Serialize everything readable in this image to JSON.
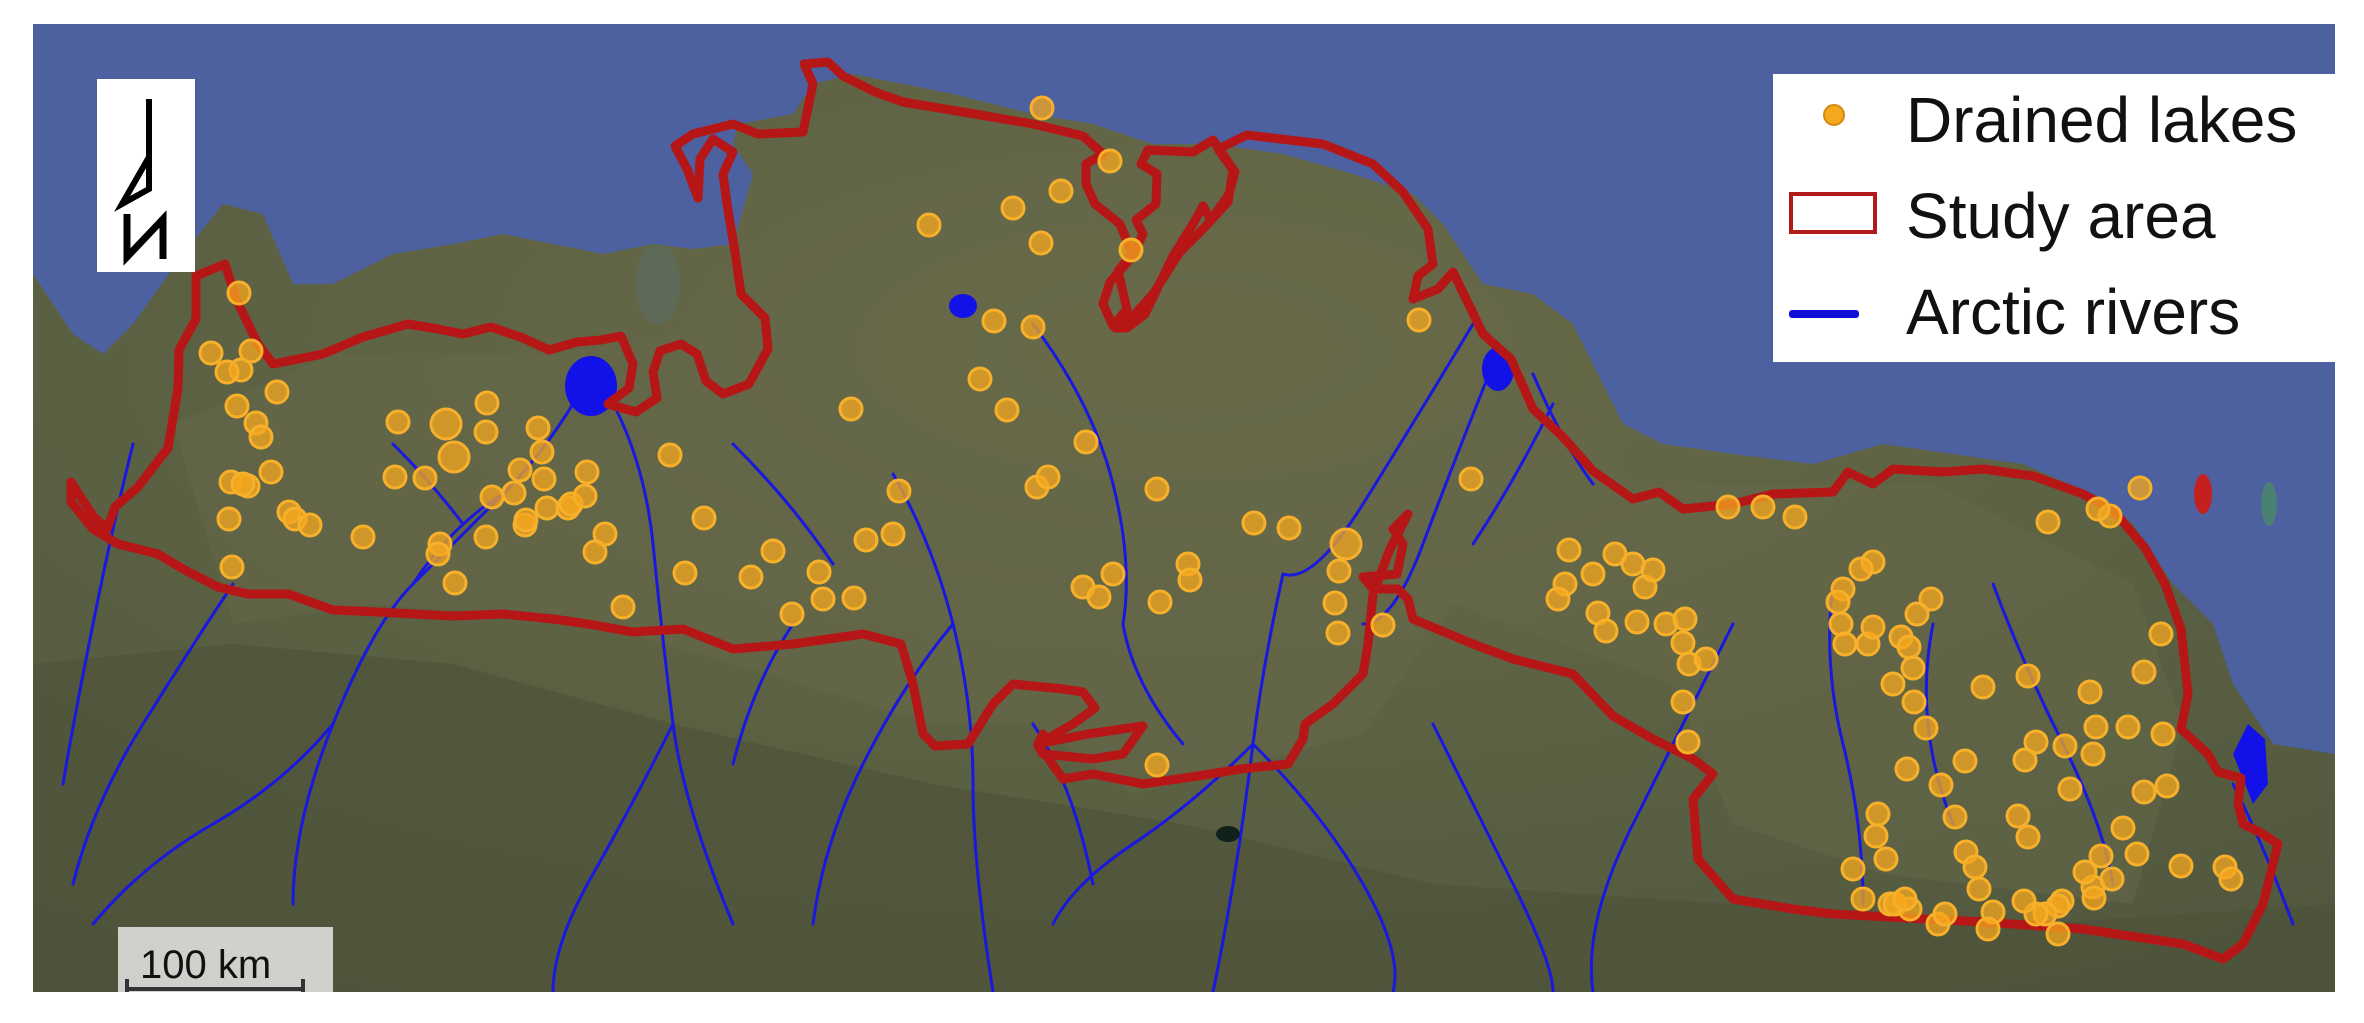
{
  "legend": {
    "items": [
      {
        "label": "Drained lakes",
        "symbol": "circle",
        "color": "#f5a71e"
      },
      {
        "label": "Study area",
        "symbol": "rectangle-outline",
        "color": "#b11a1a"
      },
      {
        "label": "Arctic rivers",
        "symbol": "line",
        "color": "#1010d8"
      }
    ]
  },
  "scale_bar": {
    "label": "100 km"
  },
  "north_arrow": {
    "icon": "north-arrow-icon",
    "letter": "N"
  },
  "colors": {
    "ocean": "#4d60a0",
    "land": "#5e6343",
    "study_area_outline": "#b11a1a",
    "rivers": "#1010d8",
    "drained_lakes": "#f5a71e"
  }
}
